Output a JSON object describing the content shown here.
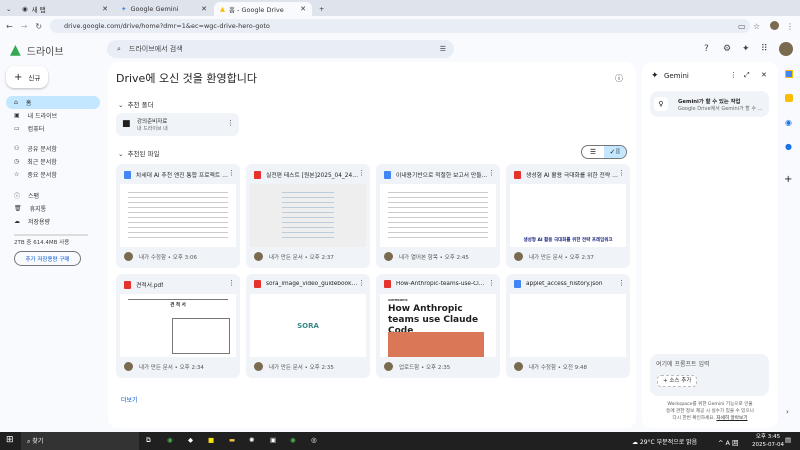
{
  "browser": {
    "tabs": [
      {
        "label": "새 탭"
      },
      {
        "label": "Google Gemini"
      },
      {
        "label": "홈 - Google Drive"
      }
    ],
    "url": "drive.google.com/drive/home?dmr=1&ec=wgc-drive-hero-goto"
  },
  "header": {
    "app_name": "드라이브",
    "search_placeholder": "드라이브에서 검색"
  },
  "sidebar": {
    "new_label": "신규",
    "items": [
      {
        "label": "홈"
      },
      {
        "label": "내 드라이브"
      },
      {
        "label": "컴퓨터"
      },
      {
        "label": "공유 문서함"
      },
      {
        "label": "최근 문서함"
      },
      {
        "label": "중요 문서함"
      },
      {
        "label": "스팸"
      },
      {
        "label": "휴지통"
      },
      {
        "label": "저장용량"
      }
    ],
    "storage": "2TB 중 614.4MB 사용",
    "storage_fraction": 0.0003,
    "buy_label": "추가 저장용량 구매"
  },
  "main": {
    "title": "Drive에 오신 것을 환영합니다",
    "folders_heading": "추천 폴더",
    "folder": {
      "name": "강의준비자료",
      "location": "내 드라이브 내"
    },
    "files_heading": "추천된 파일",
    "more_label": "더보기",
    "files": [
      {
        "name": "차세대 AI 추천 엔진 통합 프로젝트 추...",
        "type": "doc",
        "meta": "내가 수정함 • 오후 3:06"
      },
      {
        "name": "실전편 테스트 [원본]2025_04_24 ...",
        "type": "pdf",
        "meta": "내가 만든 문서 • 오후 2:37"
      },
      {
        "name": "이내용기반으로 적절한 보고서 만들...",
        "type": "doc",
        "meta": "내가 열어본 항목 • 오후 2:45"
      },
      {
        "name": "생성형 AI 활용 극대화를 위한 전략 프...",
        "type": "pdf",
        "meta": "내가 만든 문서 • 오후 2:37",
        "preview": "생성형 AI 활용 극대화를 위한 전략 프레임워크"
      },
      {
        "name": "견적서.pdf",
        "type": "pdf",
        "meta": "내가 만든 문서 • 오후 2:34",
        "preview": "견 적 서"
      },
      {
        "name": "sora_image_video_guidebook.pdf",
        "type": "pdf",
        "meta": "내가 만든 문서 • 오후 2:35",
        "preview": "SORA"
      },
      {
        "name": "How-Anthropic-teams-use-Clau...",
        "type": "pdf",
        "meta": "업로드함 • 오후 2:35",
        "preview": "How Anthropic teams use Claude Code",
        "preview_brand": "ANTHROPIC"
      },
      {
        "name": "applet_access_history.json",
        "type": "doc",
        "meta": "내가 수정함 • 오전 9:48"
      }
    ]
  },
  "gemini": {
    "title": "Gemini",
    "suggestion_title": "Gemini가 할 수 있는 작업",
    "suggestion_sub": "Google Drive에서 Gemini가 할 수 ...",
    "prompt_placeholder": "여기에 프롬프트 입력",
    "add_source": "소스 추가",
    "disclaimer": "Workspace를 위한 Gemini 기능으로 인물 등에 관한 정보 제공 시 실수가 있을 수 있으니 다시 한번 확인하세요.",
    "learn_more": "자세히 알아보기"
  },
  "taskbar": {
    "search": "찾기",
    "weather": "29°C 부분적으로 맑음",
    "time": "오후 3:45",
    "date": "2025-07-04"
  }
}
